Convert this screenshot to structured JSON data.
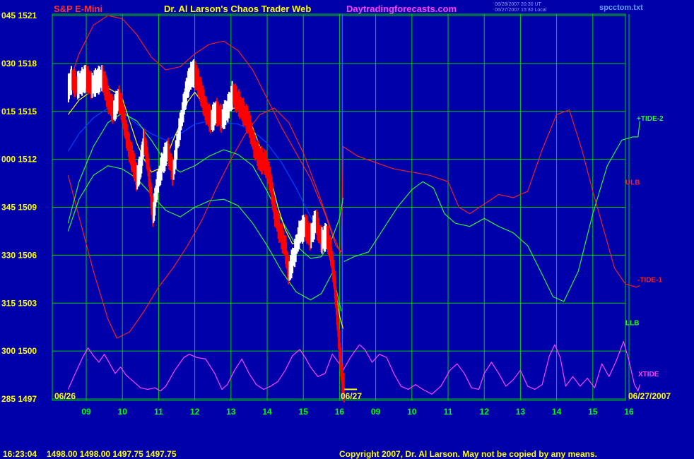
{
  "header": {
    "instrument": "S&P E-Mini",
    "site_name": "Dr. Al Larson's Chaos Trader Web",
    "url": "Daytradingforecasts.com",
    "ut_time": "06/28/2007 20:30 UT",
    "local_time": "06/27/2007 15:30 Local",
    "file_name": "spcctom.txt"
  },
  "footer": {
    "timestamp": "16:23:04",
    "ohlc": "1498.00 1498.00 1497.75 1497.75",
    "copyright": "Copyright 2007, Dr. Al Larson. May not be copied by any means."
  },
  "colors": {
    "background": "#0000aa",
    "grid": "#00cc00",
    "price_up": "#ffffff",
    "price_down": "#ff0000",
    "moving_average": "#ffff00",
    "tide_green": "#33ee33",
    "band_red": "#ee2222",
    "tide_blue": "#0044ff",
    "xtide": "#ff44ff"
  },
  "chart_data": {
    "type": "line",
    "y_axis": {
      "ticks": [
        {
          "left": "045",
          "price": 1521
        },
        {
          "left": "030",
          "price": 1518
        },
        {
          "left": "015",
          "price": 1515
        },
        {
          "left": "000",
          "price": 1512
        },
        {
          "left": "345",
          "price": 1509
        },
        {
          "left": "330",
          "price": 1506
        },
        {
          "left": "315",
          "price": 1503
        },
        {
          "left": "300",
          "price": 1500
        },
        {
          "left": "285",
          "price": 1497
        }
      ]
    },
    "x_axis": {
      "ticks": [
        "09",
        "10",
        "11",
        "12",
        "13",
        "14",
        "15",
        "16",
        "09",
        "10",
        "11",
        "12",
        "13",
        "14",
        "15",
        "16"
      ],
      "start_date": "06/26",
      "mid_date": "06/27",
      "end_date": "06/27/2007"
    },
    "session_divider_after_tick": 7,
    "series_labels": [
      {
        "name": "+TIDE-2",
        "color": "#33ee33",
        "at_price": 1514.6
      },
      {
        "name": "ULB",
        "color": "#ee2222",
        "at_price": 1510.6
      },
      {
        "name": "-TIDE-1",
        "color": "#ee2222",
        "at_price": 1504.5
      },
      {
        "name": "LLB",
        "color": "#33ee33",
        "at_price": 1501.8
      },
      {
        "name": "XTIDE",
        "color": "#ff44ff",
        "at_price": 1498.6
      }
    ],
    "price": [
      [
        8.5,
        1516.4
      ],
      [
        8.6,
        1517.0
      ],
      [
        8.75,
        1516.6
      ],
      [
        8.9,
        1516.9
      ],
      [
        9.0,
        1517.1
      ],
      [
        9.15,
        1516.6
      ],
      [
        9.3,
        1516.9
      ],
      [
        9.45,
        1517.1
      ],
      [
        9.55,
        1516.4
      ],
      [
        9.6,
        1515.8
      ],
      [
        9.75,
        1515.0
      ],
      [
        9.9,
        1515.8
      ],
      [
        10.0,
        1515.1
      ],
      [
        10.1,
        1513.7
      ],
      [
        10.2,
        1512.6
      ],
      [
        10.3,
        1511.8
      ],
      [
        10.4,
        1510.8
      ],
      [
        10.5,
        1511.5
      ],
      [
        10.6,
        1513.2
      ],
      [
        10.7,
        1511.9
      ],
      [
        10.8,
        1509.5
      ],
      [
        10.85,
        1508.5
      ],
      [
        10.95,
        1510.2
      ],
      [
        11.1,
        1511.7
      ],
      [
        11.25,
        1512.6
      ],
      [
        11.4,
        1511.1
      ],
      [
        11.55,
        1513.5
      ],
      [
        11.7,
        1515.4
      ],
      [
        11.8,
        1516.6
      ],
      [
        11.9,
        1517.3
      ],
      [
        12.0,
        1517.4
      ],
      [
        12.1,
        1516.8
      ],
      [
        12.2,
        1516.0
      ],
      [
        12.3,
        1515.1
      ],
      [
        12.45,
        1514.4
      ],
      [
        12.6,
        1515.0
      ],
      [
        12.75,
        1514.5
      ],
      [
        12.9,
        1515.1
      ],
      [
        13.05,
        1516.1
      ],
      [
        13.2,
        1515.6
      ],
      [
        13.35,
        1514.9
      ],
      [
        13.5,
        1514.3
      ],
      [
        13.65,
        1512.8
      ],
      [
        13.8,
        1512.0
      ],
      [
        13.95,
        1511.8
      ],
      [
        14.1,
        1510.6
      ],
      [
        14.2,
        1508.8
      ],
      [
        14.35,
        1507.5
      ],
      [
        14.5,
        1506.5
      ],
      [
        14.6,
        1504.9
      ],
      [
        14.75,
        1506.0
      ],
      [
        14.9,
        1507.4
      ],
      [
        15.05,
        1507.8
      ],
      [
        15.2,
        1507.1
      ],
      [
        15.35,
        1508.2
      ],
      [
        15.5,
        1506.9
      ],
      [
        15.65,
        1507.2
      ],
      [
        15.75,
        1506.4
      ],
      [
        15.85,
        1504.7
      ],
      [
        15.92,
        1502.8
      ],
      [
        16.0,
        1500.2
      ],
      [
        16.07,
        1498.4
      ],
      [
        16.13,
        1497.6
      ]
    ],
    "moving_average": [
      [
        8.5,
        1514.8
      ],
      [
        8.8,
        1515.7
      ],
      [
        9.1,
        1516.2
      ],
      [
        9.5,
        1516.6
      ],
      [
        9.8,
        1516.2
      ],
      [
        10.0,
        1515.8
      ],
      [
        10.2,
        1514.4
      ],
      [
        10.4,
        1513.0
      ],
      [
        10.6,
        1512.0
      ],
      [
        10.8,
        1511.2
      ],
      [
        11.0,
        1511.4
      ],
      [
        11.2,
        1512.0
      ],
      [
        11.4,
        1513.2
      ],
      [
        11.6,
        1514.2
      ],
      [
        11.8,
        1515.6
      ],
      [
        12.0,
        1516.2
      ],
      [
        12.2,
        1515.6
      ],
      [
        12.5,
        1515.0
      ],
      [
        12.8,
        1514.8
      ],
      [
        13.0,
        1515.2
      ],
      [
        13.3,
        1515.2
      ],
      [
        13.6,
        1514.0
      ],
      [
        13.9,
        1512.2
      ],
      [
        14.1,
        1510.8
      ],
      [
        14.3,
        1509.0
      ],
      [
        14.5,
        1507.6
      ],
      [
        14.7,
        1506.7
      ],
      [
        14.9,
        1506.9
      ],
      [
        15.1,
        1507.3
      ],
      [
        15.3,
        1507.6
      ],
      [
        15.5,
        1507.3
      ],
      [
        15.7,
        1506.2
      ],
      [
        15.85,
        1504.6
      ],
      [
        16.0,
        1502.2
      ],
      [
        16.1,
        1501.4
      ]
    ],
    "tide_green_1": [
      [
        8.5,
        1508.0
      ],
      [
        8.8,
        1510.6
      ],
      [
        9.2,
        1512.8
      ],
      [
        9.6,
        1514.3
      ],
      [
        10.0,
        1514.9
      ],
      [
        10.4,
        1514.4
      ],
      [
        10.8,
        1513.2
      ],
      [
        11.2,
        1511.8
      ],
      [
        11.6,
        1511.2
      ],
      [
        12.0,
        1511.6
      ],
      [
        12.4,
        1512.2
      ],
      [
        12.8,
        1512.6
      ],
      [
        13.2,
        1512.3
      ],
      [
        13.6,
        1511.6
      ],
      [
        14.0,
        1510.0
      ],
      [
        14.4,
        1508.2
      ],
      [
        14.8,
        1506.6
      ],
      [
        15.2,
        1505.8
      ],
      [
        15.5,
        1505.9
      ],
      [
        15.8,
        1507.1
      ],
      [
        16.0,
        1508.3
      ],
      [
        16.1,
        1509.6
      ],
      [
        16.12,
        1505.6
      ],
      [
        16.4,
        1505.9
      ],
      [
        16.8,
        1506.2
      ],
      [
        17.2,
        1507.6
      ],
      [
        17.6,
        1509.0
      ],
      [
        18.0,
        1510.1
      ],
      [
        18.3,
        1510.6
      ],
      [
        18.6,
        1510.2
      ],
      [
        18.9,
        1508.6
      ],
      [
        19.2,
        1508.0
      ],
      [
        19.6,
        1507.8
      ],
      [
        20.0,
        1508.3
      ],
      [
        20.4,
        1507.8
      ],
      [
        20.8,
        1507.4
      ],
      [
        21.2,
        1506.6
      ],
      [
        21.6,
        1504.8
      ],
      [
        21.9,
        1503.4
      ],
      [
        22.2,
        1503.1
      ],
      [
        22.6,
        1505.0
      ],
      [
        23.0,
        1508.6
      ],
      [
        23.4,
        1511.6
      ],
      [
        23.8,
        1513.2
      ],
      [
        24.1,
        1513.4
      ],
      [
        24.25,
        1513.4
      ],
      [
        24.3,
        1514.4
      ]
    ],
    "tide_green_2": [
      [
        8.5,
        1507.5
      ],
      [
        8.8,
        1509.5
      ],
      [
        9.2,
        1511.0
      ],
      [
        9.6,
        1511.6
      ],
      [
        10.0,
        1511.4
      ],
      [
        10.4,
        1510.8
      ],
      [
        10.8,
        1509.8
      ],
      [
        11.2,
        1508.8
      ],
      [
        11.6,
        1508.4
      ],
      [
        12.0,
        1509.0
      ],
      [
        12.4,
        1509.4
      ],
      [
        12.8,
        1509.5
      ],
      [
        13.2,
        1509.1
      ],
      [
        13.6,
        1508.0
      ],
      [
        14.0,
        1506.6
      ],
      [
        14.4,
        1505.0
      ],
      [
        14.8,
        1503.7
      ],
      [
        15.2,
        1503.2
      ],
      [
        15.5,
        1503.6
      ],
      [
        15.8,
        1504.9
      ],
      [
        16.05,
        1502.5
      ]
    ],
    "band_red_upper": [
      [
        8.5,
        1516.6
      ],
      [
        8.8,
        1518.6
      ],
      [
        9.2,
        1520.4
      ],
      [
        9.6,
        1521.0
      ],
      [
        10.0,
        1520.8
      ],
      [
        10.4,
        1519.8
      ],
      [
        10.8,
        1518.4
      ],
      [
        11.2,
        1517.6
      ],
      [
        11.6,
        1517.8
      ],
      [
        12.0,
        1518.6
      ],
      [
        12.4,
        1519.2
      ],
      [
        12.8,
        1519.4
      ],
      [
        13.2,
        1518.8
      ],
      [
        13.6,
        1517.6
      ],
      [
        14.0,
        1515.8
      ],
      [
        14.4,
        1514.0
      ],
      [
        14.8,
        1512.4
      ],
      [
        15.2,
        1510.8
      ],
      [
        15.6,
        1508.6
      ],
      [
        15.9,
        1506.6
      ],
      [
        16.05,
        1506.2
      ],
      [
        16.1,
        1512.8
      ],
      [
        16.5,
        1512.2
      ],
      [
        17.0,
        1511.8
      ],
      [
        17.5,
        1511.4
      ],
      [
        18.0,
        1511.2
      ],
      [
        18.5,
        1511.0
      ],
      [
        19.0,
        1510.6
      ],
      [
        19.3,
        1509.0
      ],
      [
        19.6,
        1508.6
      ],
      [
        20.0,
        1509.2
      ],
      [
        20.4,
        1509.8
      ],
      [
        20.8,
        1509.6
      ],
      [
        21.2,
        1510.0
      ],
      [
        21.6,
        1512.6
      ],
      [
        22.0,
        1514.8
      ],
      [
        22.35,
        1515.1
      ],
      [
        22.7,
        1512.6
      ],
      [
        23.0,
        1510.0
      ],
      [
        23.3,
        1507.6
      ],
      [
        23.6,
        1505.2
      ],
      [
        23.9,
        1504.2
      ],
      [
        24.2,
        1504.0
      ],
      [
        24.3,
        1504.1
      ]
    ],
    "band_red_lower": [
      [
        8.5,
        1511.0
      ],
      [
        8.8,
        1508.4
      ],
      [
        9.2,
        1505.0
      ],
      [
        9.6,
        1502.0
      ],
      [
        9.85,
        1500.8
      ],
      [
        10.2,
        1501.2
      ],
      [
        10.6,
        1502.5
      ],
      [
        11.0,
        1504.0
      ],
      [
        11.4,
        1505.2
      ],
      [
        11.8,
        1506.6
      ],
      [
        12.2,
        1508.2
      ],
      [
        12.6,
        1510.2
      ],
      [
        13.0,
        1512.0
      ],
      [
        13.4,
        1513.6
      ],
      [
        13.8,
        1514.8
      ],
      [
        14.2,
        1515.2
      ],
      [
        14.6,
        1514.3
      ],
      [
        15.0,
        1512.4
      ],
      [
        15.4,
        1510.0
      ],
      [
        15.8,
        1507.4
      ],
      [
        16.05,
        1506.0
      ]
    ],
    "tide_blue": [
      [
        8.5,
        1512.5
      ],
      [
        8.8,
        1513.6
      ],
      [
        9.2,
        1514.6
      ],
      [
        9.6,
        1515.2
      ],
      [
        10.0,
        1515.0
      ],
      [
        10.4,
        1514.2
      ],
      [
        10.8,
        1513.6
      ],
      [
        11.2,
        1513.2
      ],
      [
        11.6,
        1513.6
      ],
      [
        12.0,
        1514.2
      ],
      [
        12.4,
        1514.4
      ],
      [
        12.8,
        1514.3
      ],
      [
        13.2,
        1514.2
      ],
      [
        13.6,
        1513.8
      ],
      [
        14.0,
        1513.0
      ],
      [
        14.4,
        1511.8
      ],
      [
        14.8,
        1510.2
      ],
      [
        15.2,
        1508.4
      ],
      [
        15.6,
        1506.8
      ],
      [
        15.9,
        1506.0
      ]
    ],
    "xtide": [
      [
        8.5,
        1497.6
      ],
      [
        8.7,
        1498.6
      ],
      [
        8.9,
        1499.6
      ],
      [
        9.05,
        1500.2
      ],
      [
        9.2,
        1499.7
      ],
      [
        9.35,
        1499.3
      ],
      [
        9.5,
        1499.8
      ],
      [
        9.65,
        1499.2
      ],
      [
        9.8,
        1498.6
      ],
      [
        9.95,
        1499.0
      ],
      [
        10.1,
        1498.5
      ],
      [
        10.3,
        1498.1
      ],
      [
        10.5,
        1497.7
      ],
      [
        10.7,
        1497.6
      ],
      [
        10.9,
        1497.7
      ],
      [
        11.05,
        1497.5
      ],
      [
        11.2,
        1497.8
      ],
      [
        11.45,
        1498.8
      ],
      [
        11.7,
        1499.6
      ],
      [
        11.85,
        1499.8
      ],
      [
        12.05,
        1499.6
      ],
      [
        12.3,
        1499.5
      ],
      [
        12.55,
        1498.6
      ],
      [
        12.75,
        1497.6
      ],
      [
        12.9,
        1497.9
      ],
      [
        13.1,
        1498.8
      ],
      [
        13.3,
        1499.5
      ],
      [
        13.5,
        1498.6
      ],
      [
        13.7,
        1497.9
      ],
      [
        13.9,
        1497.6
      ],
      [
        14.1,
        1497.8
      ],
      [
        14.3,
        1498.1
      ],
      [
        14.5,
        1498.8
      ],
      [
        14.7,
        1499.7
      ],
      [
        14.9,
        1500.1
      ],
      [
        15.05,
        1499.6
      ],
      [
        15.2,
        1499.0
      ],
      [
        15.4,
        1498.4
      ],
      [
        15.6,
        1498.6
      ],
      [
        15.8,
        1499.8
      ],
      [
        16.0,
        1499.2
      ],
      [
        16.1,
        1498.8
      ],
      [
        16.3,
        1499.6
      ],
      [
        16.55,
        1500.4
      ],
      [
        16.7,
        1500.1
      ],
      [
        16.9,
        1499.3
      ],
      [
        17.1,
        1499.8
      ],
      [
        17.3,
        1499.6
      ],
      [
        17.5,
        1498.6
      ],
      [
        17.7,
        1497.8
      ],
      [
        17.9,
        1497.6
      ],
      [
        18.1,
        1497.9
      ],
      [
        18.3,
        1497.6
      ],
      [
        18.55,
        1497.3
      ],
      [
        18.8,
        1497.8
      ],
      [
        19.05,
        1498.8
      ],
      [
        19.25,
        1499.2
      ],
      [
        19.45,
        1498.6
      ],
      [
        19.65,
        1497.7
      ],
      [
        19.85,
        1497.6
      ],
      [
        20.0,
        1498.6
      ],
      [
        20.2,
        1499.3
      ],
      [
        20.4,
        1498.6
      ],
      [
        20.6,
        1497.8
      ],
      [
        20.8,
        1498.2
      ],
      [
        21.0,
        1498.8
      ],
      [
        21.2,
        1497.8
      ],
      [
        21.4,
        1497.6
      ],
      [
        21.6,
        1497.9
      ],
      [
        21.8,
        1499.7
      ],
      [
        21.95,
        1500.4
      ],
      [
        22.1,
        1499.6
      ],
      [
        22.25,
        1497.8
      ],
      [
        22.45,
        1498.4
      ],
      [
        22.65,
        1497.8
      ],
      [
        22.85,
        1498.3
      ],
      [
        23.05,
        1497.7
      ],
      [
        23.25,
        1499.2
      ],
      [
        23.45,
        1498.4
      ],
      [
        23.65,
        1499.4
      ],
      [
        23.85,
        1500.6
      ],
      [
        24.0,
        1499.4
      ],
      [
        24.15,
        1497.9
      ],
      [
        24.25,
        1497.5
      ],
      [
        24.3,
        1497.9
      ]
    ]
  }
}
